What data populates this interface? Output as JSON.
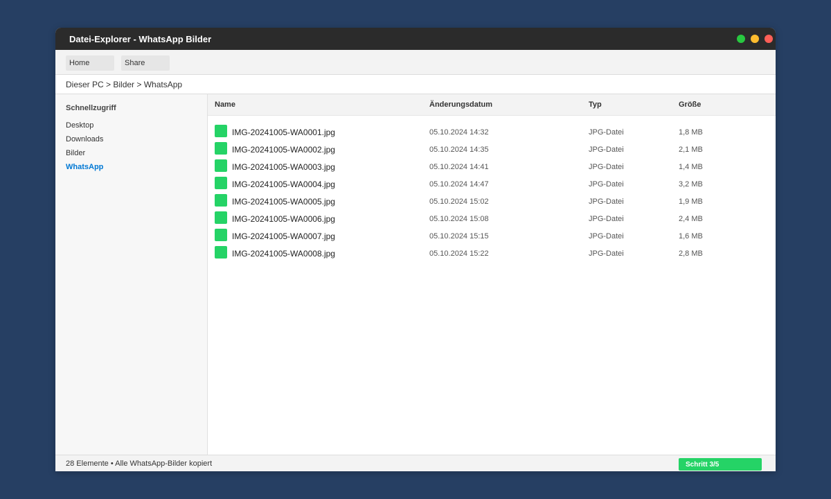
{
  "window": {
    "title": "Datei-Explorer - WhatsApp Bilder",
    "controls": {
      "green": "#28c840",
      "yellow": "#febc2e",
      "red": "#ff5f57"
    }
  },
  "toolbar": {
    "home_label": "Home",
    "share_label": "Share"
  },
  "address": {
    "path": "Dieser PC > Bilder > WhatsApp"
  },
  "sidebar": {
    "heading": "Schnellzugriff",
    "items": [
      {
        "label": "Desktop",
        "active": false
      },
      {
        "label": "Downloads",
        "active": false
      },
      {
        "label": "Bilder",
        "active": false
      },
      {
        "label": "WhatsApp",
        "active": true
      }
    ]
  },
  "columns": {
    "name": "Name",
    "date": "Änderungsdatum",
    "type": "Typ",
    "size": "Größe"
  },
  "files": [
    {
      "name": "IMG-20241005-WA0001.jpg",
      "date": "05.10.2024 14:32",
      "type": "JPG-Datei",
      "size": "1,8 MB"
    },
    {
      "name": "IMG-20241005-WA0002.jpg",
      "date": "05.10.2024 14:35",
      "type": "JPG-Datei",
      "size": "2,1 MB"
    },
    {
      "name": "IMG-20241005-WA0003.jpg",
      "date": "05.10.2024 14:41",
      "type": "JPG-Datei",
      "size": "1,4 MB"
    },
    {
      "name": "IMG-20241005-WA0004.jpg",
      "date": "05.10.2024 14:47",
      "type": "JPG-Datei",
      "size": "3,2 MB"
    },
    {
      "name": "IMG-20241005-WA0005.jpg",
      "date": "05.10.2024 15:02",
      "type": "JPG-Datei",
      "size": "1,9 MB"
    },
    {
      "name": "IMG-20241005-WA0006.jpg",
      "date": "05.10.2024 15:08",
      "type": "JPG-Datei",
      "size": "2,4 MB"
    },
    {
      "name": "IMG-20241005-WA0007.jpg",
      "date": "05.10.2024 15:15",
      "type": "JPG-Datei",
      "size": "1,6 MB"
    },
    {
      "name": "IMG-20241005-WA0008.jpg",
      "date": "05.10.2024 15:22",
      "type": "JPG-Datei",
      "size": "2,8 MB"
    }
  ],
  "file_icon": {
    "name": "whatsapp-image-file-icon",
    "color": "#25d366"
  },
  "status": {
    "text": "28 Elemente • Alle WhatsApp-Bilder kopiert",
    "step_label": "Schritt 3/5"
  },
  "colors": {
    "accent": "#0078d4",
    "whatsapp_green": "#25d366",
    "background": "#263f63"
  }
}
